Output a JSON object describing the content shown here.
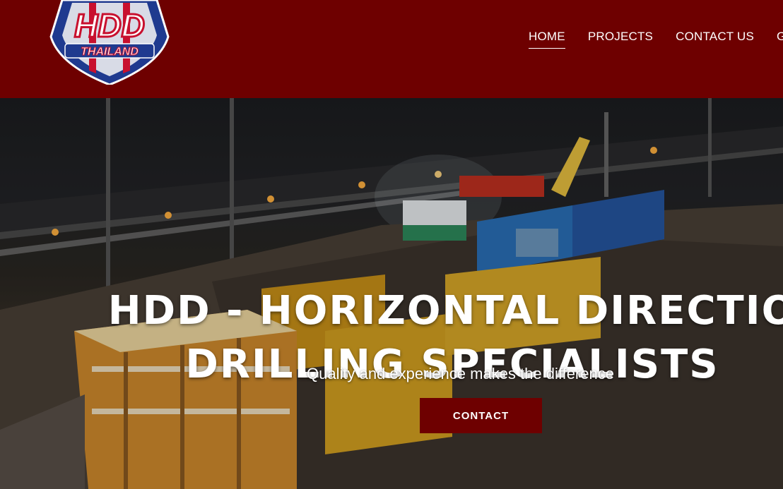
{
  "brand": {
    "logo_text": "HDD",
    "logo_subtext": "THAILAND"
  },
  "nav": {
    "items": [
      {
        "label": "HOME",
        "active": true
      },
      {
        "label": "PROJECTS",
        "active": false
      },
      {
        "label": "CONTACT US",
        "active": false
      },
      {
        "label": "GA",
        "active": false
      }
    ]
  },
  "hero": {
    "title_line1": "HDD - HORIZONTAL DIRECTIO",
    "title_line2": "DRILLING SPECIALISTS",
    "subtitle": "Quality and experience makes the difference",
    "cta_label": "CONTACT"
  },
  "colors": {
    "brand_red": "#6e0000",
    "text": "#ffffff"
  },
  "icons": {
    "logo": "shield-logo"
  }
}
